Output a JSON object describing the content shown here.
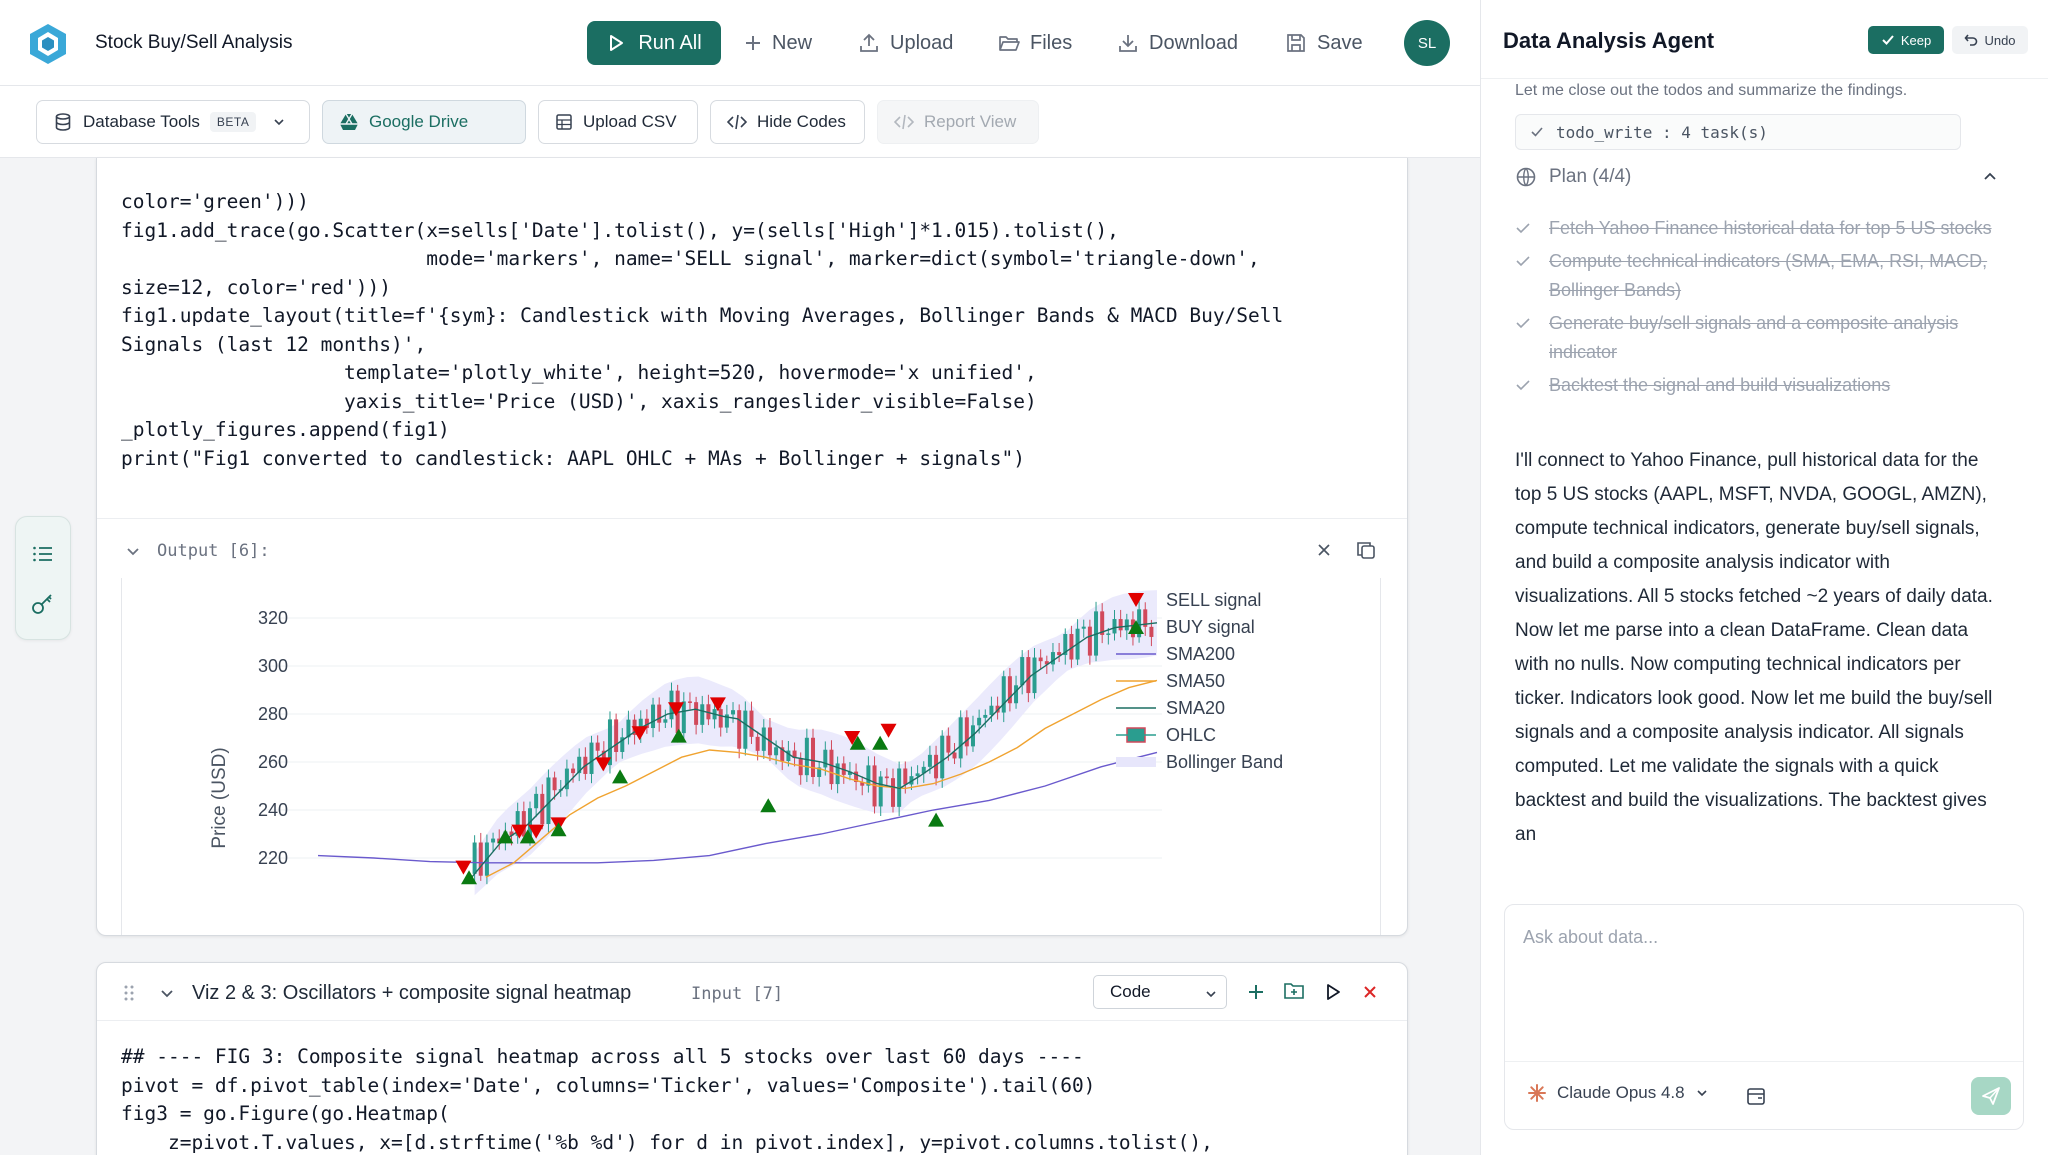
{
  "app": {
    "title": "Stock Buy/Sell Analysis",
    "avatar_initials": "SL",
    "accent": "#1b6e62"
  },
  "topbar": {
    "run_all": "Run All",
    "new": "New",
    "upload": "Upload",
    "files": "Files",
    "download": "Download",
    "save": "Save"
  },
  "toolbar": {
    "database_tools": "Database Tools",
    "beta": "BETA",
    "google_drive": "Google Drive",
    "upload_csv": "Upload CSV",
    "hide_codes": "Hide Codes",
    "report_view": "Report View"
  },
  "cell1": {
    "code_lines": [
      "color='green')))",
      "fig1.add_trace(go.Scatter(x=sells['Date'].tolist(), y=(sells['High']*1.015).tolist(),",
      "                          mode='markers', name='SELL signal', marker=dict(symbol='triangle-down',",
      "size=12, color='red')))",
      "fig1.update_layout(title=f'{sym}: Candlestick with Moving Averages, Bollinger Bands & MACD Buy/Sell",
      "Signals (last 12 months)',",
      "                   template='plotly_white', height=520, hovermode='x unified',",
      "                   yaxis_title='Price (USD)', xaxis_rangeslider_visible=False)",
      "_plotly_figures.append(fig1)",
      "print(\"Fig1 converted to candlestick: AAPL OHLC + MAs + Bollinger + signals\")"
    ],
    "output_label": "Output [6]:"
  },
  "chart_data": {
    "type": "line",
    "ylabel": "Price (USD)",
    "ylim": [
      212,
      325
    ],
    "yticks": [
      220,
      240,
      260,
      280,
      300,
      320
    ],
    "legend_position": "right",
    "legend": [
      "SELL signal",
      "BUY signal",
      "SMA200",
      "SMA50",
      "SMA20",
      "OHLC",
      "Bollinger Band"
    ],
    "colors": {
      "sell": "#e00000",
      "buy": "#0a7a12",
      "sma200": "#6a5acd",
      "sma50": "#f0a330",
      "sma20": "#1b6e62",
      "ohlc_up": "#2a9d8f",
      "ohlc_down": "#d1495b",
      "band": "#e7e6fb"
    },
    "series": [
      {
        "name": "SMA200",
        "points": [
          [
            0,
            221
          ],
          [
            20,
            220
          ],
          [
            40,
            218.5
          ],
          [
            60,
            218
          ],
          [
            80,
            218
          ],
          [
            100,
            218
          ],
          [
            120,
            219
          ],
          [
            140,
            221
          ],
          [
            160,
            226
          ],
          [
            180,
            230
          ],
          [
            200,
            235
          ],
          [
            220,
            240
          ],
          [
            240,
            244
          ],
          [
            260,
            250
          ],
          [
            280,
            258
          ],
          [
            300,
            264
          ]
        ]
      },
      {
        "name": "SMA50",
        "points": [
          [
            60,
            212
          ],
          [
            70,
            218
          ],
          [
            80,
            228
          ],
          [
            90,
            238
          ],
          [
            100,
            245
          ],
          [
            110,
            250
          ],
          [
            120,
            256
          ],
          [
            130,
            262
          ],
          [
            140,
            265
          ],
          [
            150,
            264
          ],
          [
            160,
            262
          ],
          [
            170,
            259
          ],
          [
            180,
            257
          ],
          [
            190,
            253
          ],
          [
            200,
            250
          ],
          [
            210,
            249
          ],
          [
            220,
            251
          ],
          [
            230,
            255
          ],
          [
            240,
            260
          ],
          [
            250,
            266
          ],
          [
            260,
            274
          ],
          [
            270,
            280
          ],
          [
            280,
            286
          ],
          [
            290,
            291
          ],
          [
            300,
            294
          ]
        ]
      },
      {
        "name": "SMA20",
        "points": [
          [
            55,
            212
          ],
          [
            65,
            226
          ],
          [
            75,
            234
          ],
          [
            85,
            246
          ],
          [
            95,
            258
          ],
          [
            105,
            266
          ],
          [
            115,
            274
          ],
          [
            125,
            280
          ],
          [
            135,
            282
          ],
          [
            145,
            279
          ],
          [
            150,
            278
          ],
          [
            160,
            270
          ],
          [
            170,
            262
          ],
          [
            180,
            260
          ],
          [
            190,
            256
          ],
          [
            200,
            251
          ],
          [
            208,
            249
          ],
          [
            215,
            254
          ],
          [
            225,
            262
          ],
          [
            235,
            272
          ],
          [
            245,
            284
          ],
          [
            255,
            296
          ],
          [
            265,
            304
          ],
          [
            275,
            312
          ],
          [
            285,
            316
          ],
          [
            300,
            318
          ]
        ]
      },
      {
        "name": "SELL signal",
        "points": [
          [
            52,
            216
          ],
          [
            72,
            231
          ],
          [
            78,
            231
          ],
          [
            86,
            234
          ],
          [
            102,
            259
          ],
          [
            115,
            272
          ],
          [
            128,
            282
          ],
          [
            143,
            284
          ],
          [
            191,
            270
          ],
          [
            204,
            273
          ]
        ]
      },
      {
        "name": "BUY signal",
        "points": [
          [
            54,
            212
          ],
          [
            67,
            229
          ],
          [
            75,
            229
          ],
          [
            86,
            232
          ],
          [
            108,
            254
          ],
          [
            129,
            271
          ],
          [
            161,
            242
          ],
          [
            193,
            268
          ],
          [
            201,
            268
          ],
          [
            221,
            236
          ]
        ]
      }
    ]
  },
  "cell2": {
    "title": "Viz 2 & 3: Oscillators + composite signal heatmap",
    "input_label": "Input [7]",
    "select_value": "Code",
    "code_lines": [
      "## ---- FIG 3: Composite signal heatmap across all 5 stocks over last 60 days ----",
      "pivot = df.pivot_table(index='Date', columns='Ticker', values='Composite').tail(60)",
      "fig3 = go.Figure(go.Heatmap(",
      "    z=pivot.T.values, x=[d.strftime('%b %d') for d in pivot.index], y=pivot.columns.tolist(),"
    ]
  },
  "panel": {
    "title": "Data Analysis Agent",
    "keep": "Keep",
    "undo": "Undo",
    "note": "Let me close out the todos and summarize the findings.",
    "todo_pill": "todo_write : 4 task(s)",
    "plan_title": "Plan (4/4)",
    "plan_items": [
      "Fetch Yahoo Finance historical data for top 5 US stocks",
      "Compute technical indicators (SMA, EMA, RSI, MACD, Bollinger Bands)",
      "Generate buy/sell signals and a composite analysis indicator",
      "Backtest the signal and build visualizations"
    ],
    "summary": "I'll connect to Yahoo Finance, pull historical data for the top 5 US stocks (AAPL, MSFT, NVDA, GOOGL, AMZN), compute technical indicators, generate buy/sell signals, and build a composite analysis indicator with visualizations. All 5 stocks fetched ~2 years of daily data. Now let me parse into a clean DataFrame. Clean data with no nulls. Now computing technical indicators per ticker. Indicators look good. Now let me build the buy/sell signals and a composite analysis indicator. All signals computed. Let me validate the signals with a quick backtest and build the visualizations. The backtest gives an",
    "input_placeholder": "Ask about data...",
    "model": "Claude Opus 4.8"
  }
}
